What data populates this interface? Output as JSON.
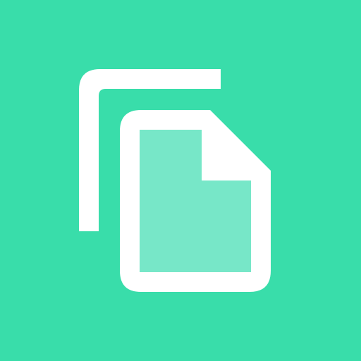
{
  "app": {
    "icon": "copy-icon",
    "colors": {
      "background": "#39DDAA",
      "foreground": "#FFFFFF",
      "page_fill": "#77E7C8"
    }
  }
}
